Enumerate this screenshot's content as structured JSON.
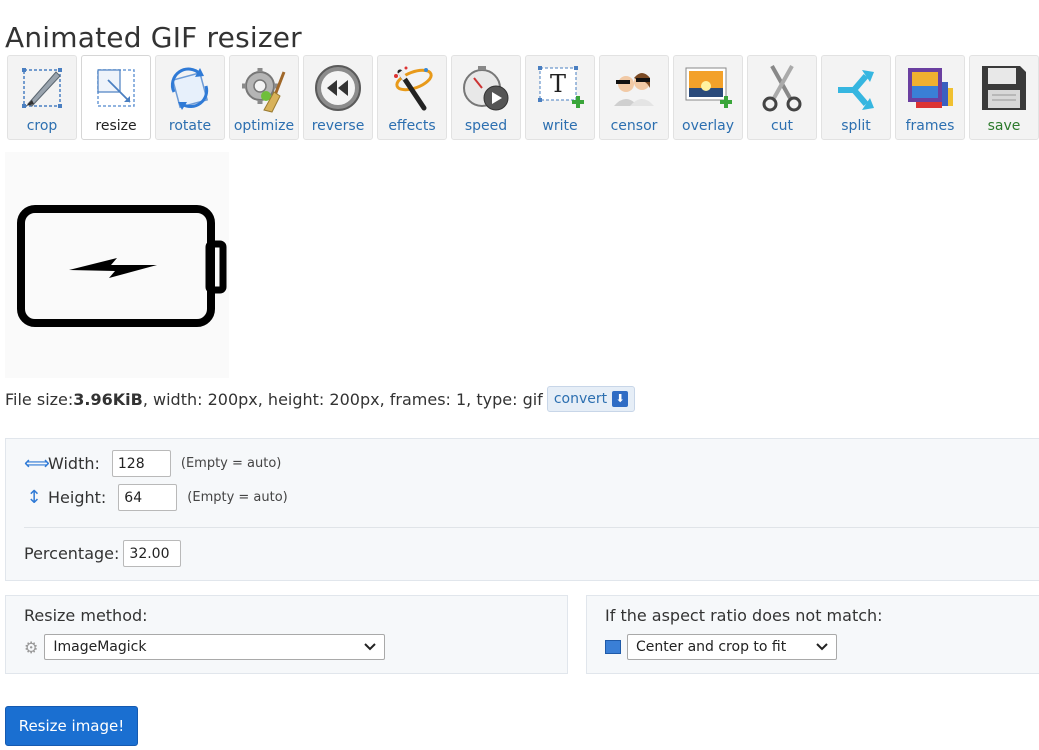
{
  "page": {
    "title": "Animated GIF resizer"
  },
  "toolbar": {
    "items": [
      {
        "label": "crop",
        "icon": "crop-icon"
      },
      {
        "label": "resize",
        "icon": "resize-icon",
        "active": true
      },
      {
        "label": "rotate",
        "icon": "rotate-icon"
      },
      {
        "label": "optimize",
        "icon": "optimize-icon"
      },
      {
        "label": "reverse",
        "icon": "reverse-icon"
      },
      {
        "label": "effects",
        "icon": "effects-icon"
      },
      {
        "label": "speed",
        "icon": "speed-icon"
      },
      {
        "label": "write",
        "icon": "write-icon"
      },
      {
        "label": "censor",
        "icon": "censor-icon"
      },
      {
        "label": "overlay",
        "icon": "overlay-icon"
      },
      {
        "label": "cut",
        "icon": "scissors-icon"
      },
      {
        "label": "split",
        "icon": "split-icon"
      },
      {
        "label": "frames",
        "icon": "frames-icon"
      },
      {
        "label": "save",
        "icon": "save-icon"
      }
    ]
  },
  "preview": {
    "icon": "battery-charging-icon"
  },
  "file_info": {
    "prefix": "File size: ",
    "size": "3.96KiB",
    "rest": ", width: 200px, height: 200px, frames: 1, type: gif",
    "convert_label": "convert"
  },
  "size": {
    "width_label": "Width:",
    "width_value": "128",
    "width_hint": "(Empty = auto)",
    "height_label": "Height:",
    "height_value": "64",
    "height_hint": "(Empty = auto)",
    "percentage_label": "Percentage:",
    "percentage_value": "32.00"
  },
  "method": {
    "title": "Resize method:",
    "selected": "ImageMagick"
  },
  "aspect": {
    "title": "If the aspect ratio does not match:",
    "selected": "Center and crop to fit"
  },
  "submit": {
    "label": "Resize image!"
  },
  "colors": {
    "link": "#2c6fb0",
    "primary": "#1a6fd1",
    "panel_bg": "#f6f8fa",
    "save_green": "#2c7a2c"
  }
}
